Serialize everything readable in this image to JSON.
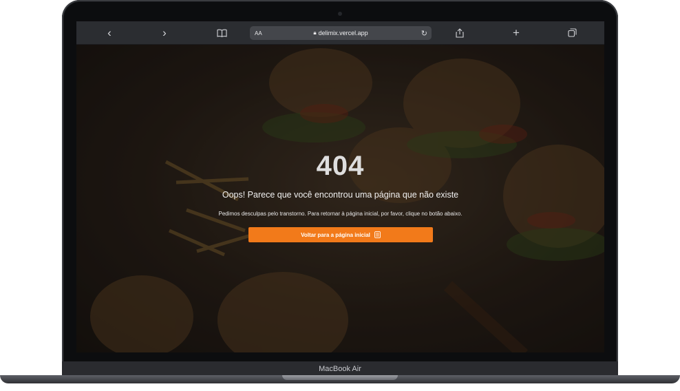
{
  "browser": {
    "url": "delimix.vercel.app",
    "text_size_label": "AA",
    "icons": {
      "back": "chevron-left-icon",
      "forward": "chevron-right-icon",
      "bookmarks": "book-icon",
      "lock": "lock-icon",
      "reload": "reload-icon",
      "share": "share-icon",
      "new_tab": "plus-icon",
      "tabs": "tabs-icon"
    }
  },
  "page": {
    "error_code": "404",
    "title": "Oops! Parece que você encontrou uma página que não existe",
    "description": "Pedimos desculpas pelo transtorno. Para retornar à página inicial, por favor, clique no botão abaixo.",
    "home_button_label": "Voltar para a página inicial",
    "accent_color": "#f27a1a"
  },
  "device": {
    "label": "MacBook Air"
  }
}
